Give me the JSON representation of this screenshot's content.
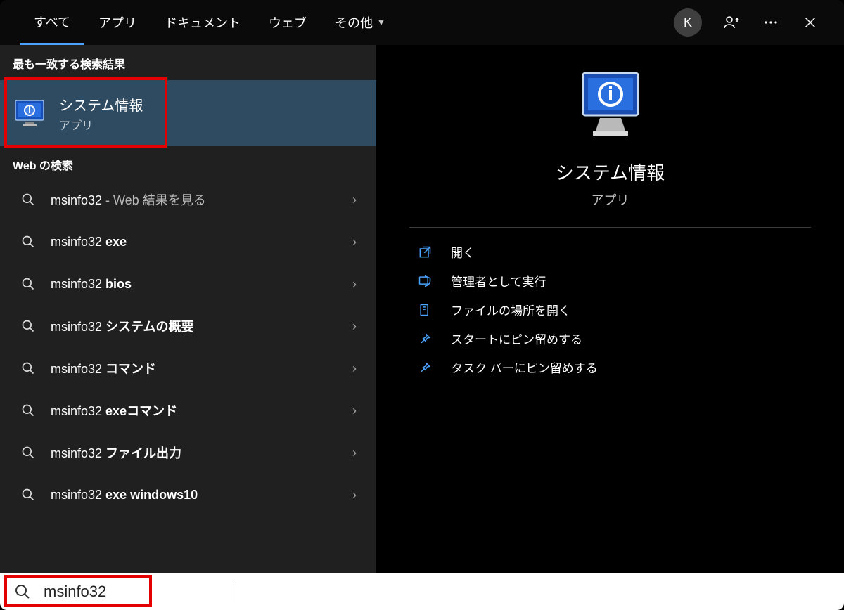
{
  "header": {
    "tabs": [
      {
        "label": "すべて",
        "active": true
      },
      {
        "label": "アプリ",
        "active": false
      },
      {
        "label": "ドキュメント",
        "active": false
      },
      {
        "label": "ウェブ",
        "active": false
      },
      {
        "label": "その他",
        "active": false,
        "dropdown": true
      }
    ],
    "avatar": "K"
  },
  "left": {
    "best_match_heading": "最も一致する検索結果",
    "best_match": {
      "title": "システム情報",
      "subtitle": "アプリ"
    },
    "web_heading": "Web の検索",
    "web_items": [
      {
        "term": "msinfo32",
        "bold": "",
        "suffix": " - Web 結果を見る"
      },
      {
        "term": "msinfo32 ",
        "bold": "exe",
        "suffix": ""
      },
      {
        "term": "msinfo32 ",
        "bold": "bios",
        "suffix": ""
      },
      {
        "term": "msinfo32 ",
        "bold": "システムの概要",
        "suffix": ""
      },
      {
        "term": "msinfo32 ",
        "bold": "コマンド",
        "suffix": ""
      },
      {
        "term": "msinfo32 ",
        "bold": "exeコマンド",
        "suffix": ""
      },
      {
        "term": "msinfo32 ",
        "bold": "ファイル出力",
        "suffix": ""
      },
      {
        "term": "msinfo32 ",
        "bold": "exe windows10",
        "suffix": ""
      }
    ]
  },
  "right": {
    "title": "システム情報",
    "subtitle": "アプリ",
    "actions": [
      {
        "icon": "open",
        "label": "開く"
      },
      {
        "icon": "admin",
        "label": "管理者として実行"
      },
      {
        "icon": "folder",
        "label": "ファイルの場所を開く"
      },
      {
        "icon": "pin",
        "label": "スタートにピン留めする"
      },
      {
        "icon": "pin",
        "label": "タスク バーにピン留めする"
      }
    ]
  },
  "search": {
    "value": "msinfo32"
  }
}
